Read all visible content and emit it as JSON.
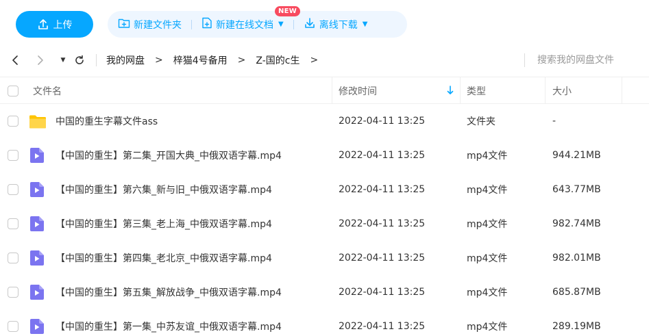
{
  "toolbar": {
    "upload_label": "上传",
    "new_folder_label": "新建文件夹",
    "new_online_doc_label": "新建在线文档",
    "new_badge": "NEW",
    "offline_download_label": "离线下载"
  },
  "nav": {
    "breadcrumbs": [
      "我的网盘",
      "梓猫4号备用",
      "Z-国的c生"
    ],
    "separator": ">",
    "search_placeholder": "搜索我的网盘文件"
  },
  "table": {
    "headers": {
      "name": "文件名",
      "modified": "修改时间",
      "type": "类型",
      "size": "大小"
    },
    "sort_column": "modified",
    "rows": [
      {
        "icon": "folder-icon",
        "name": "中国的重生字幕文件ass",
        "modified": "2022-04-11 13:25",
        "type": "文件夹",
        "size": "-"
      },
      {
        "icon": "video-file-icon",
        "name": "【中国的重生】第二集_开国大典_中俄双语字幕.mp4",
        "modified": "2022-04-11 13:25",
        "type": "mp4文件",
        "size": "944.21MB"
      },
      {
        "icon": "video-file-icon",
        "name": "【中国的重生】第六集_新与旧_中俄双语字幕.mp4",
        "modified": "2022-04-11 13:25",
        "type": "mp4文件",
        "size": "643.77MB"
      },
      {
        "icon": "video-file-icon",
        "name": "【中国的重生】第三集_老上海_中俄双语字幕.mp4",
        "modified": "2022-04-11 13:25",
        "type": "mp4文件",
        "size": "982.74MB"
      },
      {
        "icon": "video-file-icon",
        "name": "【中国的重生】第四集_老北京_中俄双语字幕.mp4",
        "modified": "2022-04-11 13:25",
        "type": "mp4文件",
        "size": "982.01MB"
      },
      {
        "icon": "video-file-icon",
        "name": "【中国的重生】第五集_解放战争_中俄双语字幕.mp4",
        "modified": "2022-04-11 13:25",
        "type": "mp4文件",
        "size": "685.87MB"
      },
      {
        "icon": "video-file-icon",
        "name": "【中国的重生】第一集_中苏友谊_中俄双语字幕.mp4",
        "modified": "2022-04-11 13:25",
        "type": "mp4文件",
        "size": "289.19MB"
      }
    ]
  },
  "colors": {
    "accent": "#06a7ff",
    "badge": "#f84b5f",
    "folder": "#ffc400",
    "video_icon": "#7b74f0"
  }
}
